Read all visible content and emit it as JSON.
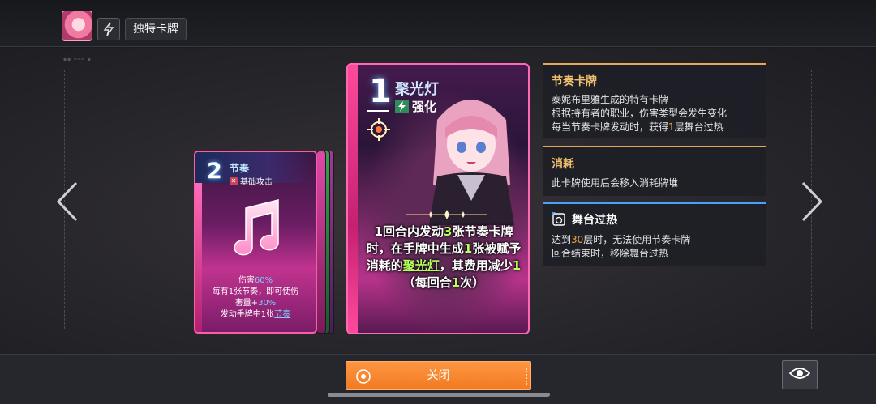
{
  "header": {
    "title": "独特卡牌",
    "avatar_icon": "character-portrait-icon",
    "bolt_icon": "lightning-bolt-icon"
  },
  "small_card": {
    "cost": "2",
    "name": "节奏",
    "type": "基础攻击",
    "icon": "music-note-icon",
    "desc_line1_prefix": "伤害",
    "desc_line1_value": "60%",
    "desc_line2": "每有1张节奏，即可使伤",
    "desc_line3_prefix": "害量+",
    "desc_line3_value": "30%",
    "desc_line4_prefix": "发动手牌中1张",
    "desc_line4_link": "节奏"
  },
  "big_card": {
    "cost": "1",
    "name": "聚光灯",
    "type": "强化",
    "desc": {
      "p1": "1回合内发动",
      "n1": "3",
      "p2": "张节奏卡牌时，在手牌中生成",
      "n2": "1",
      "p3": "张被赋予消耗的",
      "link": "聚光灯",
      "p4": "，其费用减少",
      "n3": "1",
      "p5": "（每回合",
      "n4": "1",
      "p6": "次）"
    }
  },
  "panels": {
    "rhythm": {
      "title": "节奏卡牌",
      "line1": "泰妮布里雅生成的特有卡牌",
      "line2": "根据持有者的职业，伤害类型会发生变化",
      "line3_prefix": "每当节奏卡牌发动时，获得",
      "line3_value": "1",
      "line3_suffix": "层舞台过热"
    },
    "consume": {
      "title": "消耗",
      "line1": "此卡牌使用后会移入消耗牌堆"
    },
    "overheat": {
      "title": "舞台过热",
      "line1_prefix": "达到",
      "line1_value": "30",
      "line1_suffix": "层时，无法使用节奏卡牌",
      "line2": "回合结束时，移除舞台过热"
    }
  },
  "footer": {
    "close_label": "关闭"
  },
  "colors": {
    "accent_orange": "#f07a22",
    "highlight_green": "#b4ff5c",
    "highlight_blue": "#7ad0ff",
    "panel_gold": "#e6a75a"
  }
}
